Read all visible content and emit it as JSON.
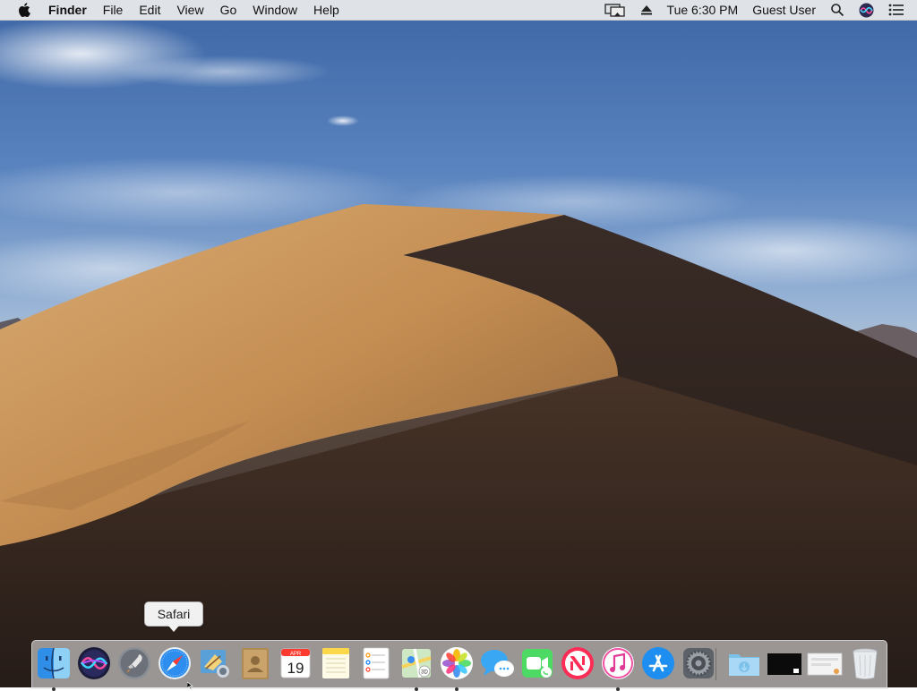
{
  "menubar": {
    "app_name": "Finder",
    "menus": [
      "File",
      "Edit",
      "View",
      "Go",
      "Window",
      "Help"
    ],
    "clock": "Tue 6:30 PM",
    "user": "Guest User",
    "status_icons": [
      "display-mirroring-icon",
      "eject-icon",
      "spotlight-search-icon",
      "siri-icon",
      "notification-center-icon"
    ]
  },
  "tooltip": {
    "label": "Safari"
  },
  "dock": {
    "apps": [
      {
        "name": "Finder",
        "icon": "finder-icon",
        "running": true
      },
      {
        "name": "Siri",
        "icon": "siri-icon",
        "running": false
      },
      {
        "name": "Launchpad",
        "icon": "launchpad-icon",
        "running": false
      },
      {
        "name": "Safari",
        "icon": "safari-icon",
        "running": false
      },
      {
        "name": "Mail",
        "icon": "mail-icon",
        "running": false
      },
      {
        "name": "Contacts",
        "icon": "contacts-icon",
        "running": false
      },
      {
        "name": "Calendar",
        "icon": "calendar-icon",
        "running": false,
        "month": "APR",
        "day": "19"
      },
      {
        "name": "Notes",
        "icon": "notes-icon",
        "running": false
      },
      {
        "name": "Reminders",
        "icon": "reminders-icon",
        "running": false
      },
      {
        "name": "Maps",
        "icon": "maps-icon",
        "running": true
      },
      {
        "name": "Photos",
        "icon": "photos-icon",
        "running": true
      },
      {
        "name": "Messages",
        "icon": "messages-icon",
        "running": false
      },
      {
        "name": "FaceTime",
        "icon": "facetime-icon",
        "running": false
      },
      {
        "name": "News",
        "icon": "news-icon",
        "running": false
      },
      {
        "name": "iTunes",
        "icon": "itunes-icon",
        "running": true
      },
      {
        "name": "App Store",
        "icon": "app-store-icon",
        "running": false
      },
      {
        "name": "System Preferences",
        "icon": "system-preferences-icon",
        "running": false
      }
    ],
    "stacks": [
      {
        "name": "Downloads",
        "icon": "downloads-folder-icon"
      },
      {
        "name": "Screenshot",
        "icon": "screenshot-stack-icon"
      },
      {
        "name": "Screenshot",
        "icon": "screenshot-stack-icon"
      },
      {
        "name": "Trash",
        "icon": "trash-icon"
      }
    ]
  },
  "colors": {
    "sky_top": "#3f68a6",
    "dune_light": "#d6a56a",
    "dune_shadow": "#2c211d",
    "menubar_bg": "#ececec"
  }
}
